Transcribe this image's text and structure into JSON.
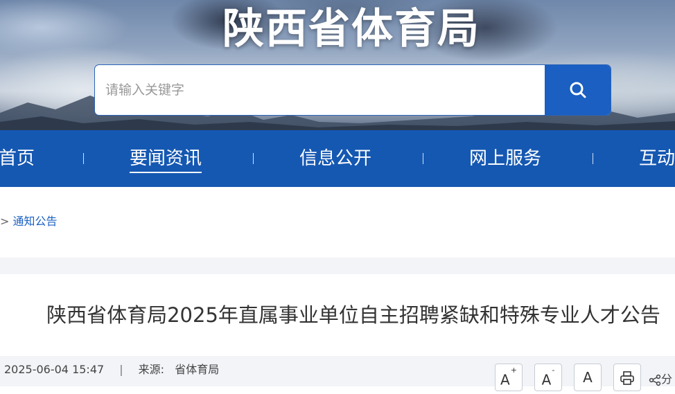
{
  "site": {
    "title": "陕西省体育局"
  },
  "search": {
    "placeholder": "请输入关键字"
  },
  "nav": {
    "items": [
      {
        "label": "首页"
      },
      {
        "label": "要闻资讯",
        "active": true
      },
      {
        "label": "信息公开"
      },
      {
        "label": "网上服务"
      },
      {
        "label": "互动"
      }
    ]
  },
  "breadcrumb": {
    "separator": ">",
    "current": "通知公告"
  },
  "article": {
    "title": "陕西省体育局2025年直属事业单位自主招聘紧缺和特殊专业人才公告",
    "date": "2025-06-04 15:47",
    "divider": "|",
    "source_label": "来源:",
    "source_value": "省体育局"
  },
  "tools": {
    "font_increase": "A",
    "font_increase_mark": "+",
    "font_decrease": "A",
    "font_decrease_mark": "-",
    "font_default": "A",
    "share_label": "分"
  },
  "colors": {
    "brand": "#1558b2",
    "search_button": "#1a5fc1",
    "link": "#1a5fc1"
  },
  "icons": {
    "search": "search-icon",
    "print": "print-icon",
    "share": "share-icon"
  }
}
